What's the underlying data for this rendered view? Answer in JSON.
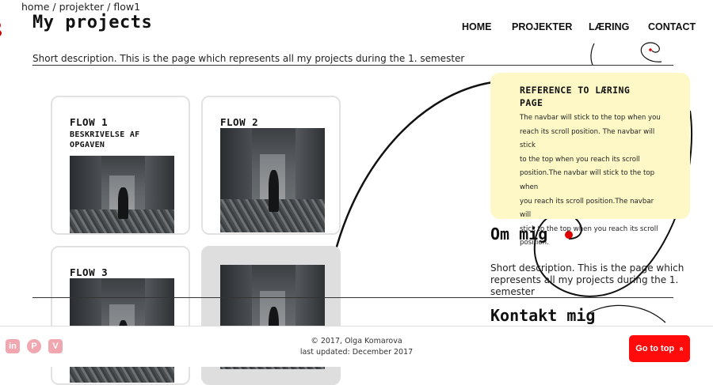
{
  "breadcrumb": "home / projekter / flow1",
  "page_title": "My projects",
  "nav": {
    "home": "HOME",
    "projekter": "PROJEKTER",
    "laering": "LÆRING",
    "contact": "CONTACT"
  },
  "description": "Short description. This is the page which represents all my projects during the 1. semester",
  "cards": [
    {
      "title": "FLOW 1",
      "subtitle_line1": "BESKRIVELSE AF",
      "subtitle_line2": "OPGAVEN"
    },
    {
      "title": "FLOW 2"
    },
    {
      "title": "FLOW 3"
    },
    {
      "title": ""
    }
  ],
  "tooltip": {
    "title_line1": "REFERENCE TO LÆRING",
    "title_line2": "PAGE",
    "body_lines": [
      "The navbar will stick to the top when you",
      "reach its scroll position. The navbar will stick",
      "to the top when you reach its scroll",
      "position.The navbar will stick to the top when",
      "you reach its scroll position.The navbar will",
      "stick to the top when you reach its scroll",
      "position."
    ]
  },
  "about": {
    "heading": "Om mig",
    "text_line1": "Short description. This is the page which",
    "text_line2": "represents all my projects during the 1.",
    "text_line3": "semester"
  },
  "contact_heading": "Kontakt mig",
  "footer": {
    "copyright": "© 2017, Olga Komarova",
    "updated": "last updated: December 2017",
    "go_to_top": "Go to top",
    "go_to_top_icon": "»"
  },
  "social_icons": [
    "linkedin-icon",
    "pinterest-icon",
    "vimeo-icon"
  ],
  "colors": {
    "accent": "#ff0b0b",
    "tooltip_bg": "#fdf8c6",
    "social": "#f0a7b0",
    "card_border": "#e2e2e2"
  }
}
